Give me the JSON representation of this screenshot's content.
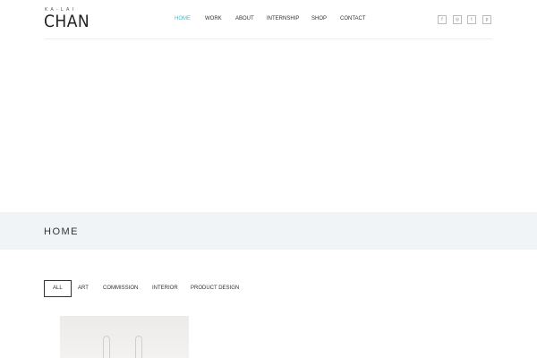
{
  "logo": {
    "sub": "KA-LAI",
    "main": "CHAN"
  },
  "nav": {
    "items": [
      {
        "label": "HOME",
        "active": true
      },
      {
        "label": "WORK",
        "active": false
      },
      {
        "label": "ABOUT",
        "active": false
      },
      {
        "label": "INTERNSHIP",
        "active": false
      },
      {
        "label": "SHOP",
        "active": false
      },
      {
        "label": "CONTACT",
        "active": false
      }
    ],
    "active_color": "#3cc2c8"
  },
  "social": [
    {
      "icon": "facebook-icon",
      "glyph": "f"
    },
    {
      "icon": "instagram-icon",
      "glyph": "◎"
    },
    {
      "icon": "twitter-icon",
      "glyph": "t"
    },
    {
      "icon": "pinterest-icon",
      "glyph": "p"
    }
  ],
  "page": {
    "title": "HOME"
  },
  "filters": [
    {
      "label": "ALL",
      "active": true
    },
    {
      "label": "ART",
      "active": false
    },
    {
      "label": "COMMISSION",
      "active": false
    },
    {
      "label": "INTERIOR",
      "active": false
    },
    {
      "label": "PRODUCT DESIGN",
      "active": false
    }
  ],
  "colors": {
    "band": "#f1f4f7",
    "text": "#333333"
  }
}
